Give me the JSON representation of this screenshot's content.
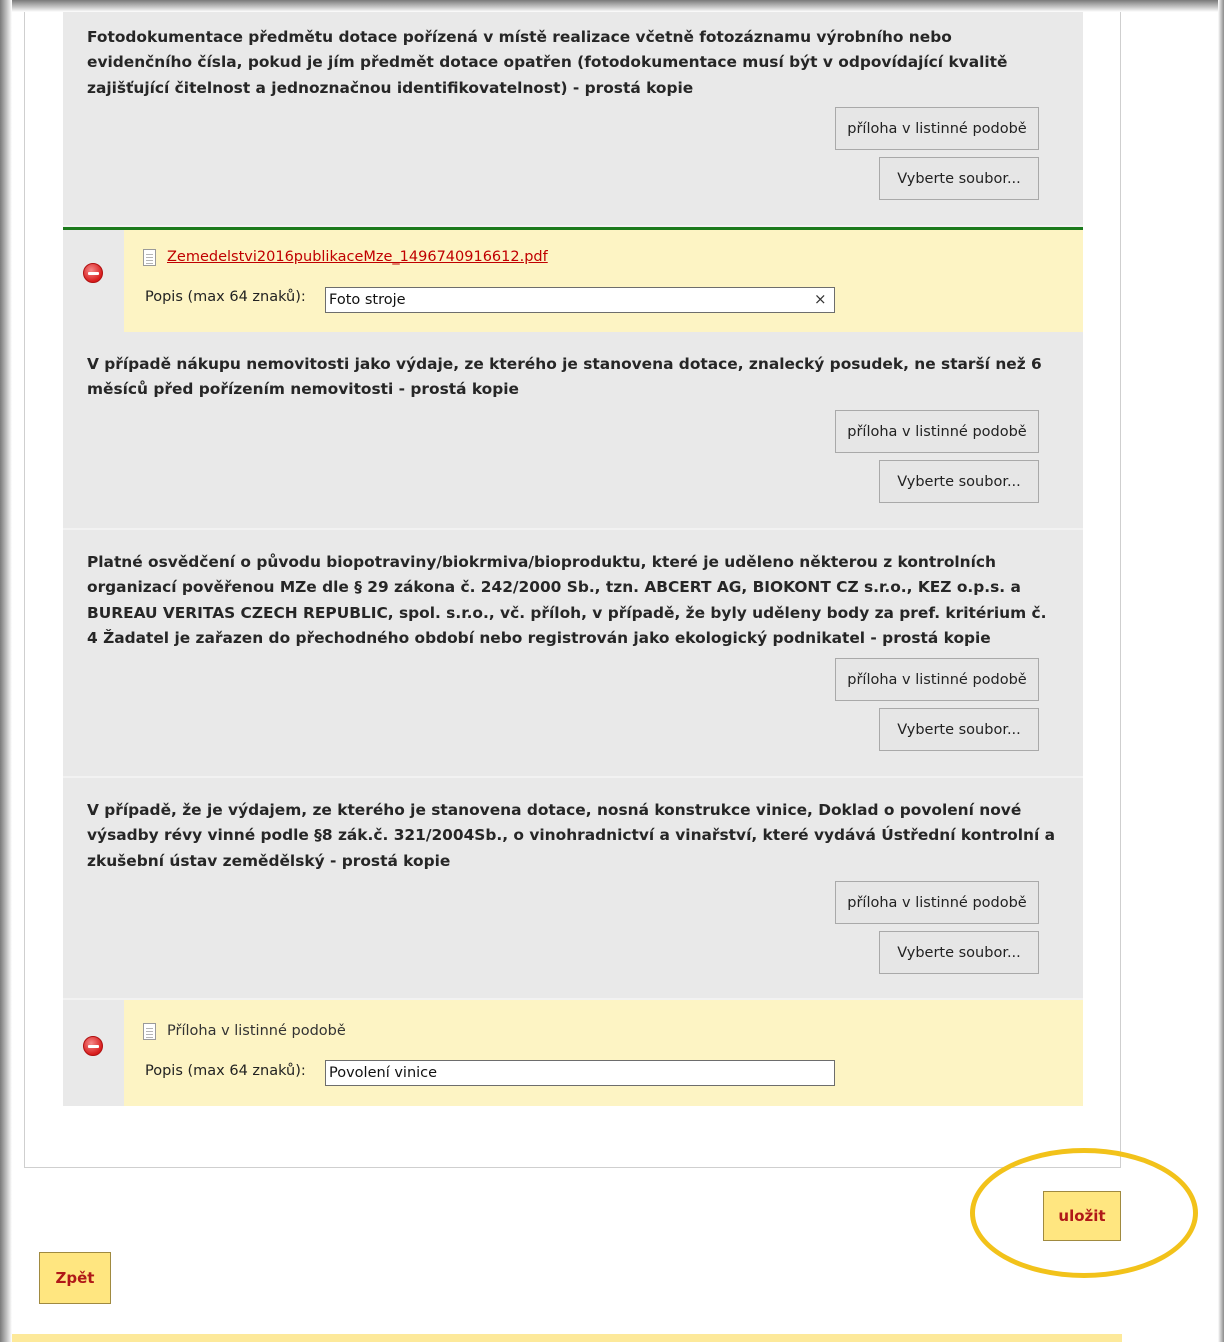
{
  "requirements": [
    {
      "text": "Fotodokumentace předmětu dotace pořízená v místě realizace včetně fotozáznamu výrobního nebo evidenčního čísla, pokud je jím předmět dotace opatřen (fotodokumentace musí být v odpovídající kvalitě zajišťující čitelnost a jednoznačnou identifikovatelnost) - prostá kopie",
      "paper_button": "příloha v listinné podobě",
      "file_button": "Vyberte soubor..."
    },
    {
      "text": "V případě nákupu nemovitosti jako výdaje, ze kterého je stanovena dotace, znalecký posudek, ne starší než 6 měsíců před pořízením nemovitosti - prostá kopie",
      "paper_button": "příloha v listinné podobě",
      "file_button": "Vyberte soubor..."
    },
    {
      "text": "Platné osvědčení o původu biopotraviny/biokrmiva/bioproduktu, které je uděleno některou z kontrolních organizací pověřenou MZe dle § 29 zákona č. 242/2000 Sb., tzn. ABCERT AG, BIOKONT CZ s.r.o., KEZ o.p.s. a BUREAU VERITAS CZECH REPUBLIC, spol. s.r.o., vč. příloh, v případě, že byly uděleny body za pref. kritérium č. 4 Žadatel je zařazen do přechodného období nebo registrován jako ekologický podnikatel - prostá kopie",
      "paper_button": "příloha v listinné podobě",
      "file_button": "Vyberte soubor..."
    },
    {
      "text": "V případě, že je výdajem, ze kterého je stanovena dotace, nosná konstrukce vinice, Doklad o povolení nové výsadby révy vinné podle §8 zák.č. 321/2004Sb., o vinohradnictví a vinařství, které vydává Ústřední kontrolní a zkušební ústav zemědělský - prostá kopie",
      "paper_button": "příloha v listinné podobě",
      "file_button": "Vyberte soubor..."
    }
  ],
  "attachments": [
    {
      "file_name": "Zemedelstvi2016publikaceMze_1496740916612.pdf",
      "popis_label": "Popis (max 64 znaků):",
      "popis_value": "Foto stroje",
      "clear_symbol": "×"
    },
    {
      "file_name": "Příloha v listinné podobě",
      "popis_label": "Popis (max 64 znaků):",
      "popis_value": "Povolení vinice"
    }
  ],
  "actions": {
    "save": "uložit",
    "back": "Zpět"
  },
  "colors": {
    "attachment_bg": "#fdf4c4",
    "requirement_bg": "#e9e9e9",
    "accent_button": "#ffe680",
    "button_text": "#b01818",
    "highlight": "#f2c21a",
    "link": "#c00000"
  }
}
